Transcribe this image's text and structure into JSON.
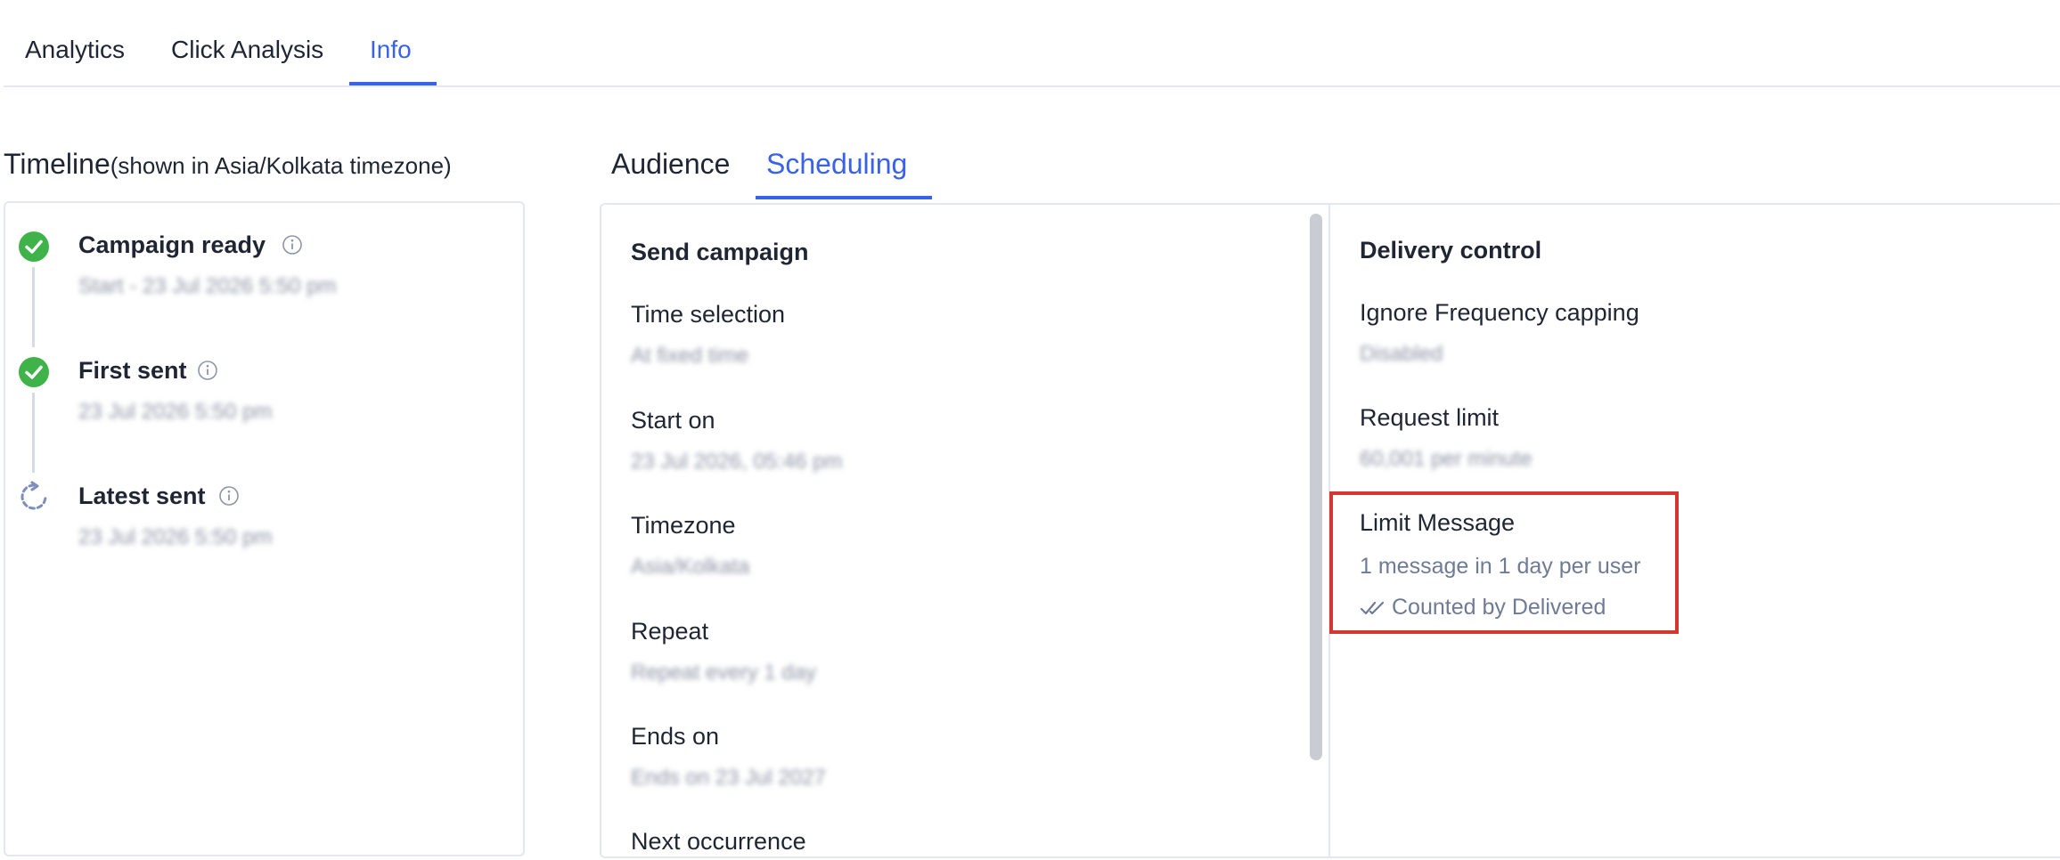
{
  "top_tabs": [
    {
      "label": "Analytics"
    },
    {
      "label": "Click Analysis"
    },
    {
      "label": "Info"
    }
  ],
  "timeline": {
    "title": "Timeline",
    "subtitle": "(shown in Asia/Kolkata timezone)",
    "items": [
      {
        "label": "Campaign ready",
        "status_icon": "check-circle-icon",
        "detail": "Start - 23 Jul 2026 5:50 pm"
      },
      {
        "label": "First sent",
        "status_icon": "check-circle-icon",
        "detail": "23 Jul 2026 5:50 pm"
      },
      {
        "label": "Latest sent",
        "status_icon": "refresh-icon",
        "detail": "23 Jul 2026 5:50 pm"
      }
    ]
  },
  "sub_tabs": [
    {
      "label": "Audience"
    },
    {
      "label": "Scheduling"
    }
  ],
  "send_campaign": {
    "title": "Send campaign",
    "fields": [
      {
        "label": "Time selection",
        "value": "At fixed time"
      },
      {
        "label": "Start on",
        "value": "23 Jul 2026, 05:46 pm"
      },
      {
        "label": "Timezone",
        "value": "Asia/Kolkata"
      },
      {
        "label": "Repeat",
        "value": "Repeat every 1 day"
      },
      {
        "label": "Ends on",
        "value": "Ends on 23 Jul 2027"
      },
      {
        "label": "Next occurrence",
        "value": ""
      }
    ]
  },
  "delivery_control": {
    "title": "Delivery control",
    "fields": [
      {
        "label": "Ignore Frequency capping",
        "value": "Disabled"
      },
      {
        "label": "Request limit",
        "value": "60,001 per minute"
      }
    ],
    "limit_message": {
      "label": "Limit Message",
      "value": "1 message in 1 day per user",
      "counted_by": "Counted by Delivered"
    }
  },
  "colors": {
    "accent": "#3a62e6",
    "success": "#3fb34a",
    "highlight": "#d2382f"
  }
}
